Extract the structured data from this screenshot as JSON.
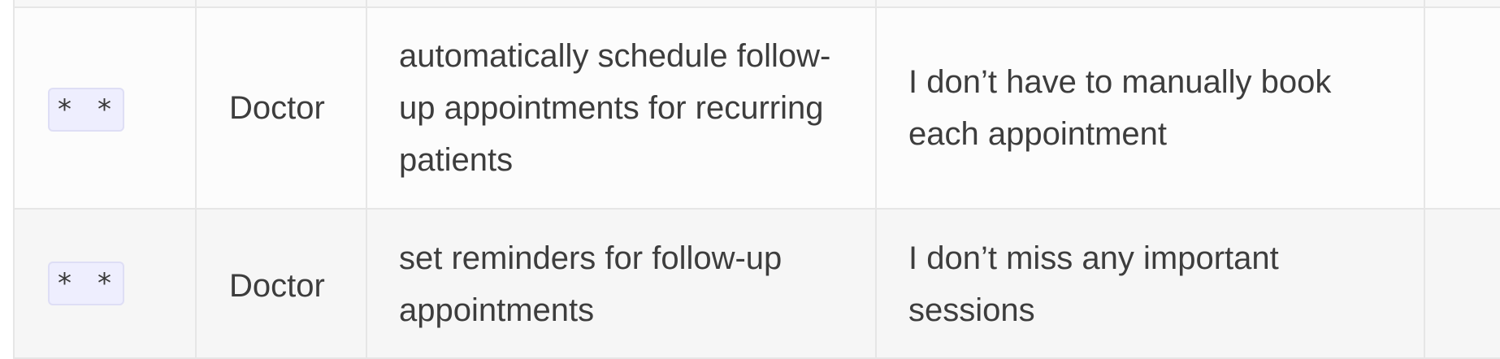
{
  "table": {
    "rows": [
      {
        "priority": "* *",
        "role": "Doctor",
        "goal": "automatically schedule follow-up appointments for recurring patients",
        "benefit": "I don’t have to manually book each appointment"
      },
      {
        "priority": "* *",
        "role": "Doctor",
        "goal": "set reminders for follow-up appointments",
        "benefit": "I don’t miss any important sessions"
      }
    ]
  },
  "colors": {
    "border": "#e6e6e6",
    "row_odd_bg": "#fcfcfc",
    "row_even_bg": "#f6f6f6",
    "badge_bg": "#eeeefe",
    "text": "#3d3d3d"
  }
}
